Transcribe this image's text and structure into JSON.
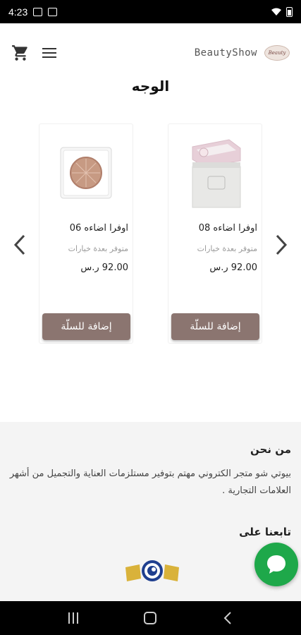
{
  "status_bar": {
    "time": "4:23"
  },
  "header": {
    "brand_name": "BeautyShow",
    "logo_text": "Beauty"
  },
  "section": {
    "title": "الوجه"
  },
  "products": [
    {
      "name": "اوفرا اضاءه 08",
      "availability": "متوفر بعدة خيارات",
      "price": "92.00 ر.س",
      "button_label": "إضافة للسلّة"
    },
    {
      "name": "اوفرا اضاءه 06",
      "availability": "متوفر بعدة خيارات",
      "price": "92.00 ر.س",
      "button_label": "إضافة للسلّة"
    }
  ],
  "footer": {
    "about_title": "من نحن",
    "about_text": "بيوتي شو متجر الكتروني مهتم بتوفير مستلزمات العناية والتجميل من أشهر العلامات التجارية .",
    "follow_title": "تابعنا على"
  },
  "colors": {
    "button": "#8b7570",
    "chat": "#1ea84a",
    "footer_bg": "#f4f4f4"
  }
}
